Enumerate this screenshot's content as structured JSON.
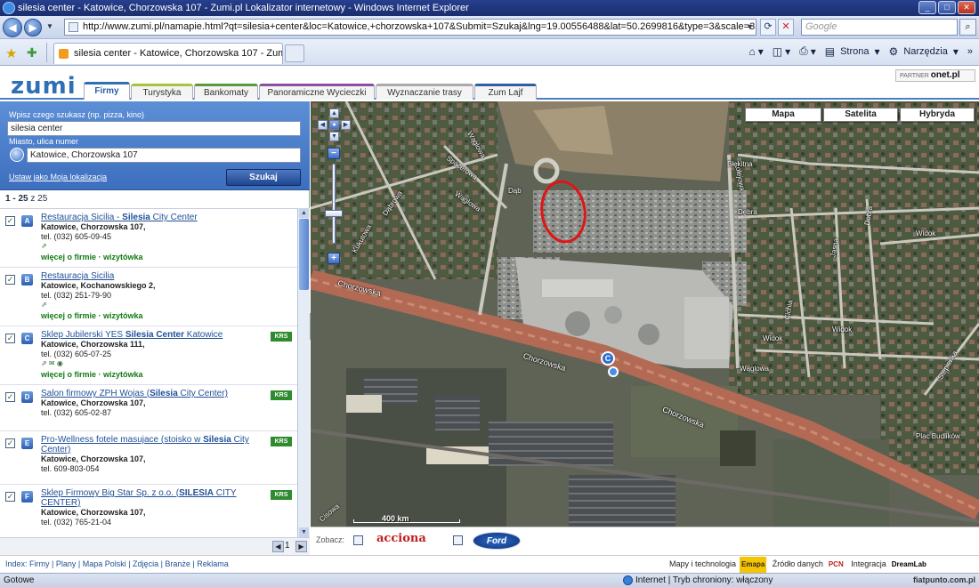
{
  "window": {
    "title": "silesia center - Katowice, Chorzowska 107 - Zumi.pl Lokalizator internetowy - Windows Internet Explorer",
    "minimize": "_",
    "maximize": "□",
    "close": "✕"
  },
  "browser": {
    "url": "http://www.zumi.pl/namapie.html?qt=silesia+center&loc=Katowice,+chorzowska+107&Submit=Szukaj&lng=19.00556488&lat=50.2699816&type=3&scale=3",
    "search_placeholder": "Google",
    "tab_title": "silesia center - Katowice, Chorzowska 107 - Zumi ...",
    "cmd_page": "Strona",
    "cmd_tools": "Narzędzia",
    "status_left": "Gotowe",
    "status_zone": "Internet | Tryb chroniony: włączony",
    "status_right": "fiatpunto.com.pl"
  },
  "site": {
    "logo": "zumi",
    "partner_label": "PARTNER",
    "partner_name": "onet.pl",
    "tabs": [
      {
        "label": "Firmy",
        "color": "#2f6fb5"
      },
      {
        "label": "Turystyka",
        "color": "#a7c43a"
      },
      {
        "label": "Bankomaty",
        "color": "#5a9a3a"
      },
      {
        "label": "Panoramiczne Wycieczki",
        "color": "#8a4fa0"
      },
      {
        "label": "Wyznaczanie trasy",
        "color": "#aaaaaa"
      },
      {
        "label": "Zum Lajf",
        "color": "#2f5f9f"
      }
    ]
  },
  "search": {
    "what_label": "Wpisz czego szukasz (np. pizza, kino)",
    "what_value": "silesia center",
    "where_label": "Miasto, ulica numer",
    "where_value": "Katowice, Chorzowska 107",
    "set_location": "Ustaw jako Moja lokalizacja",
    "submit": "Szukaj"
  },
  "results_count": {
    "range": "1 - 25",
    "suffix": "z 25"
  },
  "results": [
    {
      "letter": "A",
      "name_pre": "Restauracja Sicilia - ",
      "name_hl": "Silesia",
      "name_post": " City Center",
      "address": "Katowice, Chorzowska 107,",
      "tel": "tel. (032) 605-09-45",
      "icons": "⇗",
      "krs": "",
      "more": "więcej o firmie · wizytówka"
    },
    {
      "letter": "B",
      "name_pre": "Restauracja Sicilia",
      "name_hl": "",
      "name_post": "",
      "address": "Katowice, Kochanowskiego 2,",
      "tel": "tel. (032) 251-79-90",
      "icons": "⇗",
      "krs": "",
      "more": "więcej o firmie · wizytówka"
    },
    {
      "letter": "C",
      "name_pre": "Sklep Jubilerski YES ",
      "name_hl": "Silesia Center",
      "name_post": " Katowice",
      "address": "Katowice, Chorzowska 111,",
      "tel": "tel. (032) 605-07-25",
      "icons": "⇗ ✉ ◉",
      "krs": "KRS",
      "more": "więcej o firmie · wizytówka"
    },
    {
      "letter": "D",
      "name_pre": "Salon firmowy ZPH Wojas (",
      "name_hl": "Silesia",
      "name_post": " City Center)",
      "address": "Katowice, Chorzowska 107,",
      "tel": "tel. (032) 605-02-87",
      "icons": "",
      "krs": "KRS",
      "more": ""
    },
    {
      "letter": "E",
      "name_pre": "Pro-Wellness fotele masujace (stoisko w ",
      "name_hl": "Silesia",
      "name_post": " City Center)",
      "address": "Katowice, Chorzowska 107,",
      "tel": "tel. 609-803-054",
      "icons": "",
      "krs": "KRS",
      "more": ""
    },
    {
      "letter": "F",
      "name_pre": "Sklep Firmowy Big Star Sp. z o.o. (",
      "name_hl": "SILESIA",
      "name_post": " CITY CENTER)",
      "address": "Katowice, Chorzowska 107,",
      "tel": "tel. (032) 765-21-04",
      "icons": "",
      "krs": "KRS",
      "more": ""
    }
  ],
  "pager": {
    "page": "1",
    "prev": "◀",
    "next": "▶"
  },
  "map": {
    "types": [
      "Mapa",
      "Satelita",
      "Hybryda"
    ],
    "scale": "400 km",
    "streets": [
      "Chorzowska",
      "Chorzowska",
      "Chorzowska",
      "Dąb",
      "Wąglowa",
      "Dąbrowa",
      "Spacerowa",
      "Kolejowa",
      "Błękitna",
      "Dębra",
      "Cichia",
      "Jasna",
      "Dobra",
      "Widok",
      "Widok",
      "Widok",
      "Wąglowa",
      "Wąglowa",
      "Plac Budlików",
      "Stepienka",
      "Kukutowa",
      "Cisowa"
    ],
    "marker": "C"
  },
  "sponsor": {
    "label": "Zobacz:",
    "brand1": "acciona",
    "brand2": "Ford"
  },
  "footer": {
    "links": "Index: Firmy | Plany | Mapa Polski | Zdjęcia | Branże | Reklama",
    "tech_label": "Mapy i technologia",
    "tech_brand": "Emapa",
    "data_label": "Źródło danych",
    "data_brand": "PCN",
    "integ_label": "Integracja",
    "integ_brand": "DreamLab"
  },
  "colors": {
    "accent": "#2f6fb5",
    "panel": "#4a7fcb",
    "road": "#b96a54",
    "highlight_circle": "#e01515"
  }
}
